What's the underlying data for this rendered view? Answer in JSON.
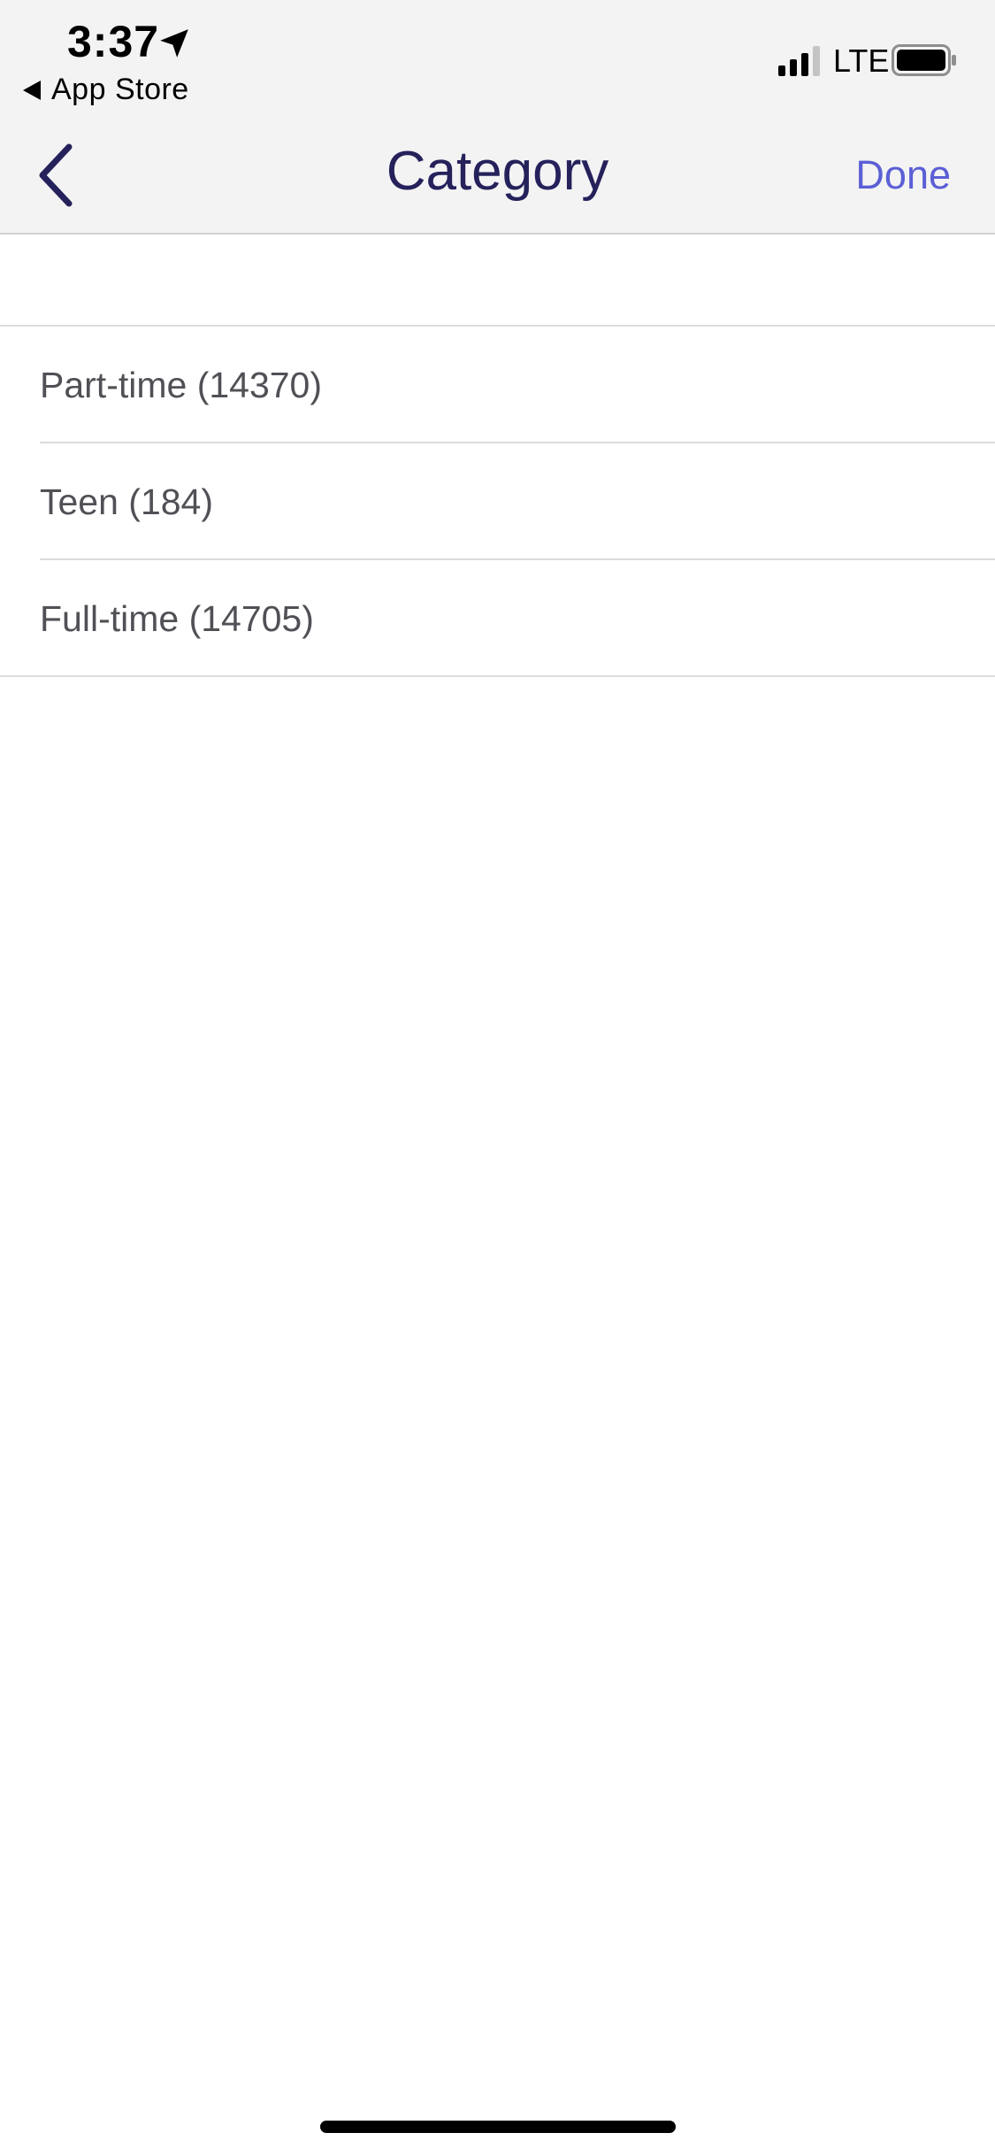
{
  "status_bar": {
    "time": "3:37",
    "back_app_label": "App Store",
    "network": "LTE"
  },
  "nav": {
    "title": "Category",
    "done_label": "Done"
  },
  "categories": [
    {
      "label": "Part-time (14370)"
    },
    {
      "label": "Teen (184)"
    },
    {
      "label": "Full-time (14705)"
    }
  ],
  "colors": {
    "title": "#25215b",
    "accent": "#5b5fd6",
    "item_text": "#505056",
    "chrome_bg": "#f3f3f3"
  }
}
